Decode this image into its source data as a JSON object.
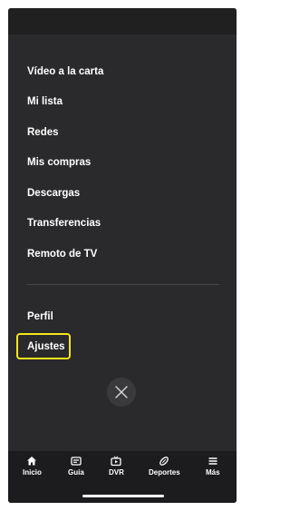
{
  "menu": {
    "items": [
      {
        "label": "Vídeo a la carta"
      },
      {
        "label": "Mi lista"
      },
      {
        "label": "Redes"
      },
      {
        "label": "Mis compras"
      },
      {
        "label": "Descargas"
      },
      {
        "label": "Transferencias"
      },
      {
        "label": "Remoto de TV"
      }
    ],
    "secondary": [
      {
        "label": "Perfil"
      },
      {
        "label": "Ajustes",
        "highlighted": true
      }
    ]
  },
  "close_icon": "close-icon",
  "tabbar": {
    "tabs": [
      {
        "label": "Inicio",
        "icon": "home-icon"
      },
      {
        "label": "Guía",
        "icon": "guide-icon"
      },
      {
        "label": "DVR",
        "icon": "dvr-icon"
      },
      {
        "label": "Deportes",
        "icon": "sports-icon"
      },
      {
        "label": "Más",
        "icon": "menu-icon"
      }
    ]
  },
  "colors": {
    "background": "#2a2a2c",
    "tabbar": "#1c1c1e",
    "highlight": "#f5e61a",
    "text": "#ffffff"
  }
}
